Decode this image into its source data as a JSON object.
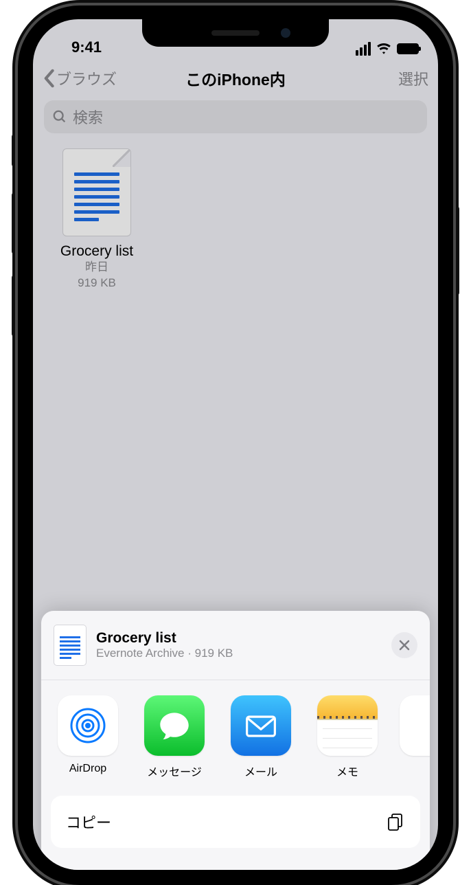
{
  "status": {
    "time": "9:41"
  },
  "nav": {
    "back": "ブラウズ",
    "title": "このiPhone内",
    "select": "選択"
  },
  "search": {
    "placeholder": "検索"
  },
  "file": {
    "name": "Grocery list",
    "date": "昨日",
    "size": "919 KB"
  },
  "sheet": {
    "title": "Grocery list",
    "subtitle": "Evernote Archive · 919 KB",
    "apps": [
      {
        "label": "AirDrop"
      },
      {
        "label": "メッセージ"
      },
      {
        "label": "メール"
      },
      {
        "label": "メモ"
      }
    ],
    "actions": {
      "copy": "コピー"
    }
  }
}
